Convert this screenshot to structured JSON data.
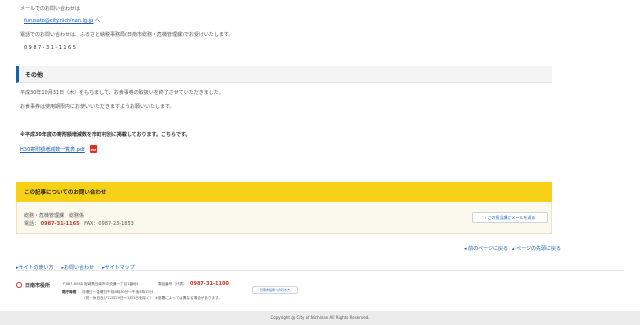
{
  "mail_section": {
    "mail_label": "メールでのお問い合わせは",
    "mail_address": "furusato@city.nichinan.lg.jp",
    "mail_suffix": "へ",
    "phone_label": "電話でのお問い合わせは、ふるさと納税事務局(日南市総務・危機管理課)でお受けいたします。",
    "phone_number": "0987-31-1165"
  },
  "sonota": {
    "heading": "その他",
    "para1": "平成30年10月31日（木）をもちまして、お食事券の取扱いを終了させていただきました。",
    "para2": "お食事券は使用期限内にお使いいただきますようお願いいたします。",
    "notice": "※平成30年度の寄附額増減数を市町村別に掲載しております。こちらです。",
    "pdf_link": "H30寄附額増減数一覧表.pdf",
    "pdf_icon": "pdf-icon",
    "pdf_icon_text": "PDF"
  },
  "contact": {
    "heading": "この記事についてのお問い合わせ",
    "department": "総務・危機管理課　総務係",
    "tel_label": "電話：",
    "tel": "0987-31-1165",
    "fax": "FAX：0987-23-1853",
    "mail_button": "この担当課にメールを送る"
  },
  "page_nav": {
    "prev": "前のページに戻る",
    "top": "ページの先頭に戻る"
  },
  "utility_links": [
    "サイトの使い方",
    "お問い合わせ",
    "サイトマップ"
  ],
  "footer": {
    "city_name": "日南市役所",
    "address": "〒887-8585 宮崎県日南市中央通一丁目1番地1",
    "rep_phone_label": "電話番号（代表）",
    "rep_phone": "0987-31-1100",
    "hours_label": "開庁時間",
    "hours_line1": "月曜日～金曜日午前8時30分～午後5時15分",
    "hours_line2": "（祝・休日及び12月29日～1月3日を除く）　※部署によっては異なる場合があります。",
    "access_button": "日南市役所への行き方",
    "copyright": "Copyright @ City of Nichinan All Rights Reserved."
  },
  "colors": {
    "accent_yellow": "#f7d117",
    "link_blue": "#1a5fb4",
    "heading_border": "#1f5ea8",
    "highlight_red": "#c0392b"
  }
}
